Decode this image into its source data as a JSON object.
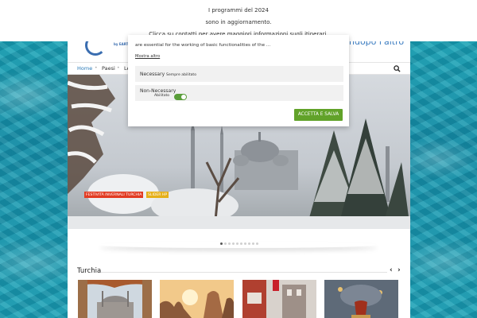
{
  "notice": {
    "line1": "I programmi del 2024",
    "line2": "sono in aggiornamento.",
    "line3": "Clicca su contatti per avere maggiori informazioni sugli itinerari."
  },
  "header": {
    "logo_sub": "by EARTH",
    "slogan": "ndopo l'altro",
    "nav": {
      "home": "Home",
      "paesi": "Paesi",
      "le": "Le"
    },
    "search_icon": "search-icon"
  },
  "hero": {
    "tags": [
      "FESTIVITÀ INVERNALI TURCHIA",
      "SLIDER HP"
    ],
    "slide_count": 10,
    "active_slide": 1
  },
  "section": {
    "title": "Turchia",
    "prev_icon": "chevron-left-icon",
    "next_icon": "chevron-right-icon"
  },
  "cookie_modal": {
    "text": "are essential for the working of basic functionalities of the ...",
    "more": "Mostra altro",
    "necessary": {
      "label": "Necessary",
      "status": "Sempre abilitato"
    },
    "non_necessary": {
      "label": "Non-Necessary",
      "status": "Abilitato",
      "enabled": true
    },
    "accept": "ACCETTA E SALVA"
  },
  "colors": {
    "accent_green": "#61a229",
    "link_blue": "#2a7ab8",
    "tag_red": "#e23b22",
    "tag_yellow": "#e6b019"
  }
}
